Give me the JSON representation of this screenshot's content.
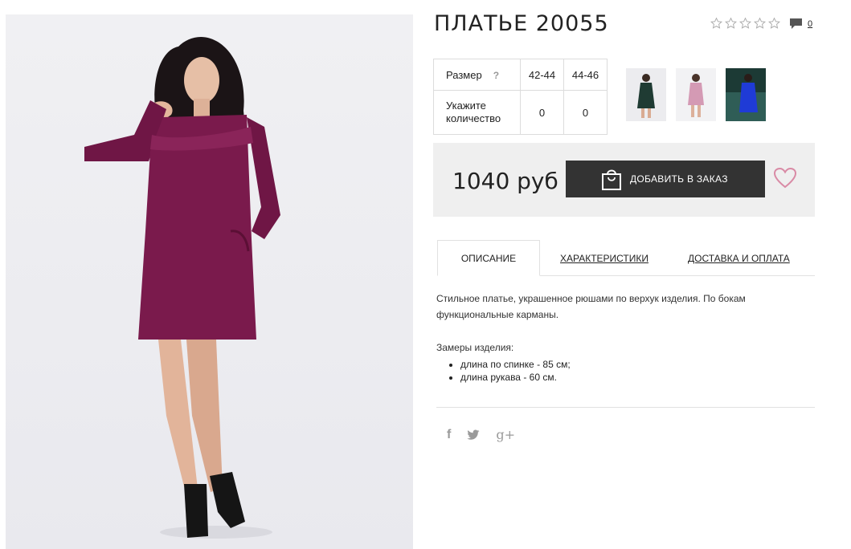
{
  "product": {
    "title": "ПЛАТЬЕ 20055",
    "rating_stars": 0,
    "comments_count": "0"
  },
  "size_table": {
    "size_label": "Размер",
    "help_mark": "?",
    "sizes": [
      "42-44",
      "44-46"
    ],
    "quantity_label_line1": "Укажите",
    "quantity_label_line2": "количество",
    "quantities": [
      "0",
      "0"
    ]
  },
  "thumbnails": [
    {
      "name": "dark-green",
      "color": "#1f3b33"
    },
    {
      "name": "pink",
      "color": "#d49ab4"
    },
    {
      "name": "blue",
      "color": "#1f3bd6"
    }
  ],
  "price": {
    "amount": "1040 руб"
  },
  "cart": {
    "add_label": "ДОБАВИТЬ В ЗАКАЗ"
  },
  "tabs": [
    {
      "label": "ОПИСАНИЕ",
      "active": true
    },
    {
      "label": "ХАРАКТЕРИСТИКИ",
      "active": false
    },
    {
      "label": "ДОСТАВКА И ОПЛАТА",
      "active": false
    }
  ],
  "description": {
    "text": "Стильное платье, украшенное рюшами по верхук изделия. По бокам функциональные карманы.",
    "measures_title": "Замеры изделия:",
    "measures": [
      "длина по спинке - 85 см;",
      "длина рукава - 60 см."
    ]
  },
  "social": {
    "facebook": "f",
    "twitter": "t",
    "googleplus": "g+"
  },
  "colors": {
    "dress": "#7a1a4c",
    "button": "#333333",
    "heart": "#d98aa5",
    "price_bg": "#efefef"
  }
}
